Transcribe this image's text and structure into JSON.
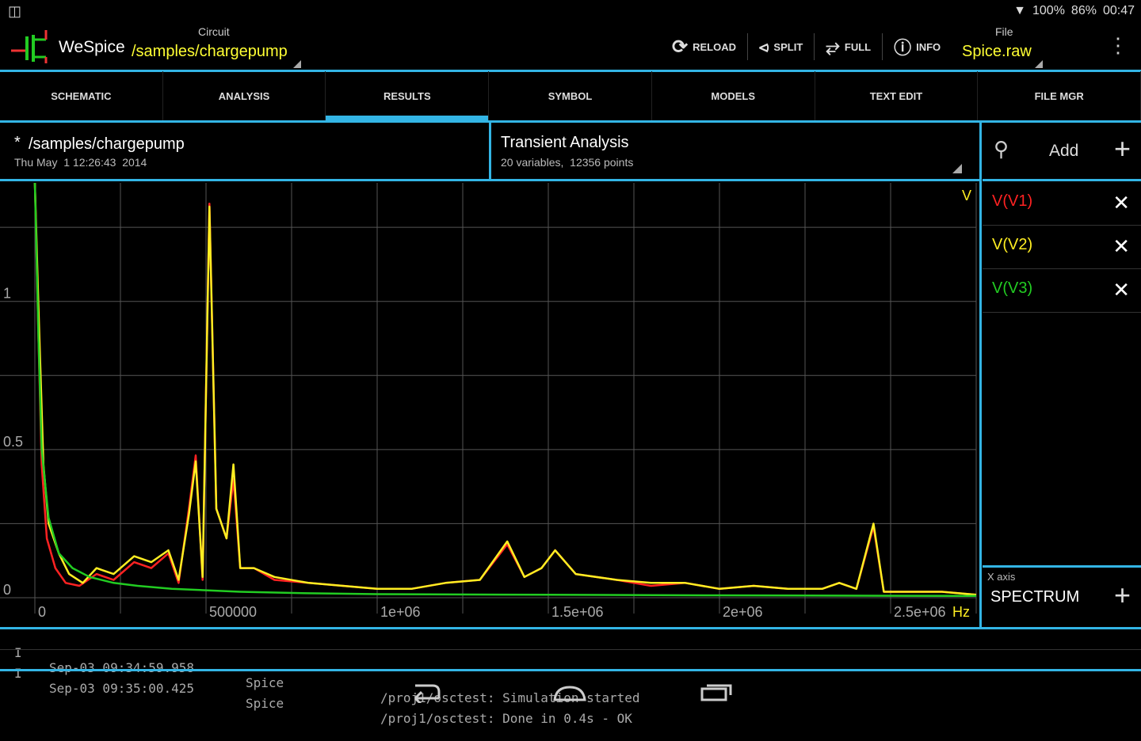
{
  "status_bar": {
    "battery": "100%",
    "signal": "86%",
    "time": "00:47"
  },
  "action_bar": {
    "app_name": "WeSpice",
    "circuit_label": "Circuit",
    "circuit_path": "/samples/chargepump",
    "buttons": [
      {
        "label": "RELOAD",
        "icon": "reload-icon"
      },
      {
        "label": "SPLIT",
        "icon": "split-icon"
      },
      {
        "label": "FULL",
        "icon": "fullscreen-icon"
      },
      {
        "label": "INFO",
        "icon": "info-icon"
      }
    ],
    "file_label": "File",
    "file_name": "Spice.raw"
  },
  "tabs": [
    {
      "label": "SCHEMATIC",
      "active": false
    },
    {
      "label": "ANALYSIS",
      "active": false
    },
    {
      "label": "RESULTS",
      "active": true
    },
    {
      "label": "SYMBOL",
      "active": false
    },
    {
      "label": "MODELS",
      "active": false
    },
    {
      "label": "TEXT EDIT",
      "active": false
    },
    {
      "label": "FILE MGR",
      "active": false
    }
  ],
  "results_header": {
    "file_marker": "*",
    "file_path": "/samples/chargepump",
    "file_date": "Thu May  1 12:26:43  2014",
    "analysis_title": "Transient Analysis",
    "analysis_info": "20 variables,  12356 points"
  },
  "right_panel": {
    "add_label": "Add",
    "traces": [
      {
        "label": "V(V1)",
        "color": "#ff2222"
      },
      {
        "label": "V(V2)",
        "color": "#ffee22"
      },
      {
        "label": "V(V3)",
        "color": "#22cc22"
      }
    ],
    "xaxis_label": "X axis",
    "xaxis_value": "SPECTRUM"
  },
  "chart_data": {
    "type": "line",
    "x_unit": "Hz",
    "y_unit": "V",
    "xlim": [
      0,
      2750000
    ],
    "ylim": [
      0,
      1.4
    ],
    "x_ticks": [
      {
        "value": 0,
        "label": "0"
      },
      {
        "value": 500000,
        "label": "500000"
      },
      {
        "value": 1000000,
        "label": "1e+06"
      },
      {
        "value": 1500000,
        "label": "1.5e+06"
      },
      {
        "value": 2000000,
        "label": "2e+06"
      },
      {
        "value": 2500000,
        "label": "2.5e+06"
      }
    ],
    "y_ticks": [
      {
        "value": 0,
        "label": "0"
      },
      {
        "value": 0.5,
        "label": "0.5"
      },
      {
        "value": 1,
        "label": "1"
      }
    ],
    "grid": true,
    "series": [
      {
        "name": "V(V1)",
        "color": "#ff2222",
        "points": [
          [
            0,
            1.4
          ],
          [
            10000,
            0.9
          ],
          [
            20000,
            0.45
          ],
          [
            35000,
            0.2
          ],
          [
            60000,
            0.1
          ],
          [
            90000,
            0.05
          ],
          [
            130000,
            0.04
          ],
          [
            180000,
            0.08
          ],
          [
            230000,
            0.06
          ],
          [
            290000,
            0.12
          ],
          [
            340000,
            0.1
          ],
          [
            390000,
            0.15
          ],
          [
            420000,
            0.05
          ],
          [
            450000,
            0.3
          ],
          [
            470000,
            0.48
          ],
          [
            490000,
            0.06
          ],
          [
            510000,
            1.33
          ],
          [
            530000,
            0.3
          ],
          [
            560000,
            0.2
          ],
          [
            580000,
            0.4
          ],
          [
            600000,
            0.1
          ],
          [
            640000,
            0.1
          ],
          [
            700000,
            0.06
          ],
          [
            800000,
            0.05
          ],
          [
            900000,
            0.04
          ],
          [
            1000000,
            0.03
          ],
          [
            1100000,
            0.03
          ],
          [
            1200000,
            0.05
          ],
          [
            1300000,
            0.06
          ],
          [
            1380000,
            0.18
          ],
          [
            1430000,
            0.07
          ],
          [
            1480000,
            0.1
          ],
          [
            1520000,
            0.16
          ],
          [
            1580000,
            0.08
          ],
          [
            1700000,
            0.06
          ],
          [
            1800000,
            0.04
          ],
          [
            1900000,
            0.05
          ],
          [
            2000000,
            0.03
          ],
          [
            2100000,
            0.04
          ],
          [
            2200000,
            0.03
          ],
          [
            2300000,
            0.03
          ],
          [
            2350000,
            0.05
          ],
          [
            2400000,
            0.03
          ],
          [
            2450000,
            0.24
          ],
          [
            2480000,
            0.02
          ],
          [
            2550000,
            0.02
          ],
          [
            2650000,
            0.02
          ],
          [
            2750000,
            0.01
          ]
        ]
      },
      {
        "name": "V(V2)",
        "color": "#ffee22",
        "points": [
          [
            0,
            1.4
          ],
          [
            10000,
            1.0
          ],
          [
            25000,
            0.45
          ],
          [
            40000,
            0.25
          ],
          [
            70000,
            0.15
          ],
          [
            100000,
            0.08
          ],
          [
            140000,
            0.05
          ],
          [
            180000,
            0.1
          ],
          [
            230000,
            0.08
          ],
          [
            290000,
            0.14
          ],
          [
            340000,
            0.12
          ],
          [
            390000,
            0.16
          ],
          [
            420000,
            0.06
          ],
          [
            450000,
            0.28
          ],
          [
            470000,
            0.46
          ],
          [
            490000,
            0.07
          ],
          [
            510000,
            1.32
          ],
          [
            530000,
            0.3
          ],
          [
            560000,
            0.2
          ],
          [
            580000,
            0.45
          ],
          [
            600000,
            0.1
          ],
          [
            640000,
            0.1
          ],
          [
            700000,
            0.07
          ],
          [
            800000,
            0.05
          ],
          [
            900000,
            0.04
          ],
          [
            1000000,
            0.03
          ],
          [
            1100000,
            0.03
          ],
          [
            1200000,
            0.05
          ],
          [
            1300000,
            0.06
          ],
          [
            1380000,
            0.19
          ],
          [
            1430000,
            0.07
          ],
          [
            1480000,
            0.1
          ],
          [
            1520000,
            0.16
          ],
          [
            1580000,
            0.08
          ],
          [
            1700000,
            0.06
          ],
          [
            1800000,
            0.05
          ],
          [
            1900000,
            0.05
          ],
          [
            2000000,
            0.03
          ],
          [
            2100000,
            0.04
          ],
          [
            2200000,
            0.03
          ],
          [
            2300000,
            0.03
          ],
          [
            2350000,
            0.05
          ],
          [
            2400000,
            0.03
          ],
          [
            2450000,
            0.25
          ],
          [
            2480000,
            0.02
          ],
          [
            2550000,
            0.02
          ],
          [
            2650000,
            0.02
          ],
          [
            2750000,
            0.01
          ]
        ]
      },
      {
        "name": "V(V3)",
        "color": "#22cc22",
        "points": [
          [
            0,
            1.4
          ],
          [
            10000,
            0.9
          ],
          [
            20000,
            0.5
          ],
          [
            40000,
            0.27
          ],
          [
            70000,
            0.15
          ],
          [
            110000,
            0.1
          ],
          [
            160000,
            0.07
          ],
          [
            230000,
            0.05
          ],
          [
            300000,
            0.04
          ],
          [
            400000,
            0.03
          ],
          [
            500000,
            0.025
          ],
          [
            600000,
            0.02
          ],
          [
            800000,
            0.015
          ],
          [
            1000000,
            0.012
          ],
          [
            1500000,
            0.01
          ],
          [
            2000000,
            0.008
          ],
          [
            2750000,
            0.006
          ]
        ]
      }
    ]
  },
  "log": [
    {
      "level": "I",
      "time": "Sep-03 09:34:59.958",
      "source": "Spice",
      "message": "/proj1/osctest: Simulation started"
    },
    {
      "level": "I",
      "time": "Sep-03 09:35:00.425",
      "source": "Spice",
      "message": "/proj1/osctest: Done in 0.4s - OK"
    }
  ],
  "nav_bar": {
    "buttons": [
      "back-icon",
      "home-icon",
      "recents-icon"
    ]
  }
}
